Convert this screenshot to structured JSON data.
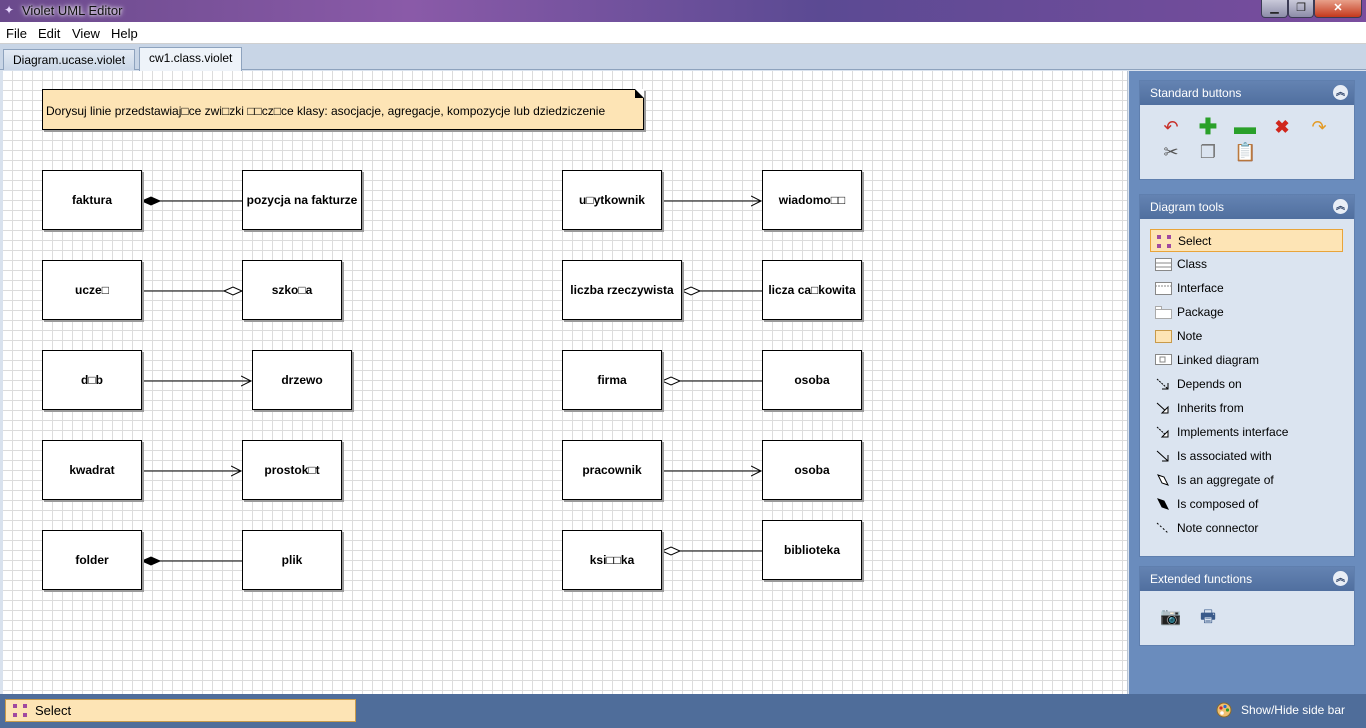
{
  "window": {
    "title": "Violet UML Editor",
    "minimize": "▁",
    "maximize": "❐",
    "close": "✕"
  },
  "menu": [
    "File",
    "Edit",
    "View",
    "Help"
  ],
  "tabs": [
    {
      "label": "Diagram.ucase.violet",
      "active": false
    },
    {
      "label": "cw1.class.violet",
      "active": true
    }
  ],
  "note": "Dorysuj linie przedstawiaj□ce zwi□zki □□cz□ce klasy: asocjacje, agregacje, kompozycje lub dziedziczenie",
  "classes": {
    "faktura": "faktura",
    "pozycja": "pozycja na fakturze",
    "uczen": "ucze□",
    "szkola": "szko□a",
    "dab": "d□b",
    "drzewo": "drzewo",
    "kwadrat": "kwadrat",
    "prostokat": "prostok□t",
    "folder": "folder",
    "plik": "plik",
    "uzytkownik": "u□ytkownik",
    "wiadomosc": "wiadomo□□",
    "rzeczywista": "liczba rzeczywista",
    "calkowita": "licza ca□kowita",
    "firma": "firma",
    "osoba1": "osoba",
    "pracownik": "pracownik",
    "osoba2": "osoba",
    "ksiazka": "ksi□□ka",
    "biblioteka": "biblioteka"
  },
  "sidebar": {
    "standard": {
      "title": "Standard buttons"
    },
    "tools": {
      "title": "Diagram tools",
      "items": [
        "Select",
        "Class",
        "Interface",
        "Package",
        "Note",
        "Linked diagram",
        "Depends on",
        "Inherits from",
        "Implements interface",
        "Is associated with",
        "Is an aggregate of",
        "Is composed of",
        "Note connector"
      ],
      "selected": "Select"
    },
    "extended": {
      "title": "Extended functions"
    }
  },
  "status": {
    "tool": "Select",
    "toggle": "Show/Hide side bar"
  },
  "colors": {
    "accent": "#fde4b5",
    "sidebar": "#6a8cbd",
    "header": "#506f9f"
  }
}
